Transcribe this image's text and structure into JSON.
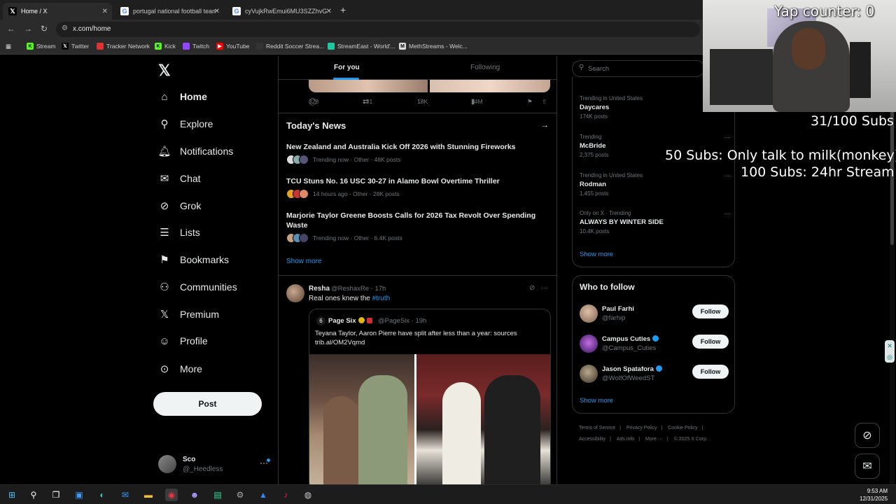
{
  "browser": {
    "tabs": [
      {
        "title": "Home / X",
        "icon": "x-icon"
      },
      {
        "title": "portugal national football team",
        "icon": "google-icon"
      },
      {
        "title": "cyVujkRwEmui6MU3SZZhvG.jpg",
        "icon": "google-icon"
      }
    ],
    "url": "x.com/home",
    "bookmarks": [
      "Stream",
      "Twitter",
      "Tracker Network",
      "Kick",
      "Twitch",
      "YouTube",
      "Reddit Soccer Strea...",
      "StreamEast - World'...",
      "MethStreams - Welc..."
    ]
  },
  "nav": {
    "items": [
      "Home",
      "Explore",
      "Notifications",
      "Chat",
      "Grok",
      "Lists",
      "Bookmarks",
      "Communities",
      "Premium",
      "Profile",
      "More"
    ],
    "post_label": "Post",
    "account_name": "Sco",
    "account_handle": "@_Heedless"
  },
  "feed": {
    "tab_for_you": "For you",
    "tab_following": "Following",
    "actions": {
      "replies": "328",
      "reposts": "131",
      "likes": "18K",
      "views": "14M"
    },
    "news_title": "Today's News",
    "news": [
      {
        "headline": "New Zealand and Australia Kick Off 2026 with Stunning Fireworks",
        "meta": "Trending now · Other · 48K posts"
      },
      {
        "headline": "TCU Stuns No. 16 USC 30-27 in Alamo Bowl Overtime Thriller",
        "meta": "14 hours ago · Other · 28K posts"
      },
      {
        "headline": "Marjorie Taylor Greene Boosts Calls for 2026 Tax Revolt Over Spending Waste",
        "meta": "Trending now · Other · 6.4K posts"
      }
    ],
    "show_more": "Show more",
    "tweet": {
      "name": "Resha",
      "handle": "@ReshaxRe · 17h",
      "text": "Real ones knew the ",
      "hashtag": "#truth",
      "quote": {
        "name": "Page Six",
        "handle": "@PageSix · 19h",
        "text": "Teyana Taylor, Aaron Pierre have split after less than a year: sources trib.al/OM2Vqmd"
      }
    }
  },
  "sidebar": {
    "search_placeholder": "Search",
    "trends": [
      {
        "context": "Trending in United States",
        "name": "Daycares",
        "count": "174K posts"
      },
      {
        "context": "Trending",
        "name": "McBride",
        "count": "2,375 posts"
      },
      {
        "context": "Trending in United States",
        "name": "Rodman",
        "count": "1,455 posts"
      },
      {
        "context": "Only on X · Trending",
        "name": "ALWAYS BY WINTER SIDE",
        "count": "10.4K posts"
      }
    ],
    "show_more": "Show more",
    "who_to_follow_title": "Who to follow",
    "follow_label": "Follow",
    "who_to_follow": [
      {
        "name": "Paul Farhi",
        "handle": "@farhip",
        "verified": false
      },
      {
        "name": "Campus Cuties",
        "handle": "@Campus_Cuties",
        "verified": true
      },
      {
        "name": "Jason Spatafora",
        "handle": "@WolfOfWeedST",
        "verified": true
      }
    ],
    "footer": [
      "Terms of Service",
      "Privacy Policy",
      "Cookie Policy",
      "Accessibility",
      "Ads info",
      "More ···",
      "© 2025 X Corp."
    ]
  },
  "overlay": {
    "yap_counter": "Yap counter: 0",
    "subs": "31/100 Subs",
    "goal1": "50 Subs: Only talk to milk(monkey)",
    "goal2": "100 Subs: 24hr Stream"
  },
  "taskbar": {
    "time": "9:53 AM",
    "date": "12/31/2025"
  },
  "colors": {
    "accent": "#1d9bf0",
    "background": "#000000",
    "text": "#e7e9ea",
    "muted": "#71767b"
  }
}
